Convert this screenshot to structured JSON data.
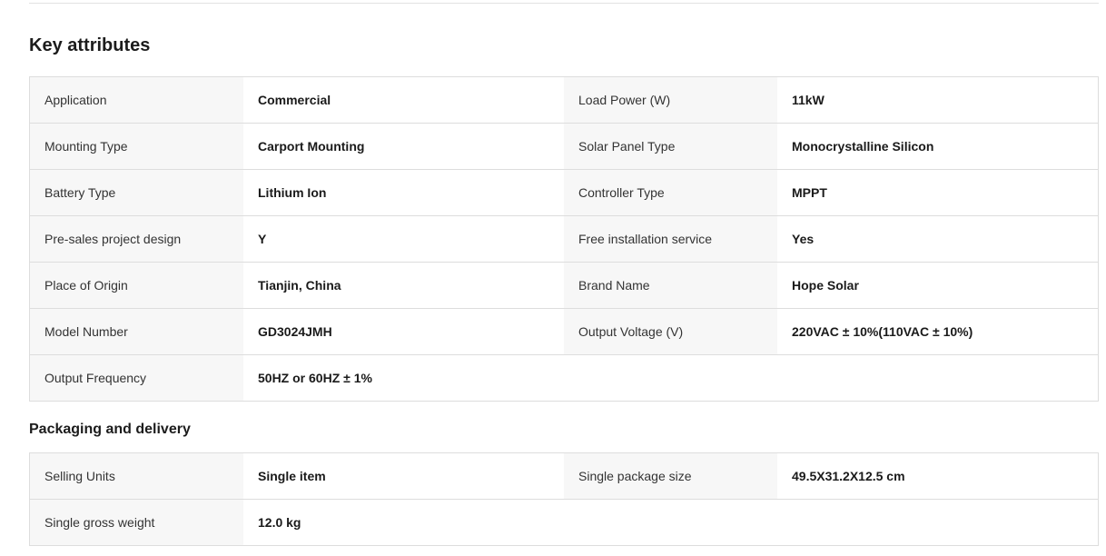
{
  "key_attributes": {
    "title": "Key attributes",
    "rows": [
      {
        "label1": "Application",
        "value1": "Commercial",
        "label2": "Load Power (W)",
        "value2": "11kW"
      },
      {
        "label1": "Mounting Type",
        "value1": "Carport Mounting",
        "label2": "Solar Panel Type",
        "value2": "Monocrystalline Silicon"
      },
      {
        "label1": "Battery Type",
        "value1": "Lithium Ion",
        "label2": "Controller Type",
        "value2": "MPPT"
      },
      {
        "label1": "Pre-sales project design",
        "value1": "Y",
        "label2": "Free installation service",
        "value2": "Yes"
      },
      {
        "label1": "Place of Origin",
        "value1": "Tianjin, China",
        "label2": "Brand Name",
        "value2": "Hope Solar"
      },
      {
        "label1": "Model Number",
        "value1": "GD3024JMH",
        "label2": "Output Voltage (V)",
        "value2": "220VAC ± 10%(110VAC ± 10%)"
      },
      {
        "label1": "Output Frequency",
        "value1": "50HZ or 60HZ ± 1%",
        "label2": "",
        "value2": ""
      }
    ]
  },
  "packaging": {
    "title": "Packaging and delivery",
    "rows": [
      {
        "label1": "Selling Units",
        "value1": "Single item",
        "label2": "Single package size",
        "value2": "49.5X31.2X12.5 cm"
      },
      {
        "label1": "Single gross weight",
        "value1": "12.0 kg",
        "label2": "",
        "value2": ""
      }
    ]
  }
}
